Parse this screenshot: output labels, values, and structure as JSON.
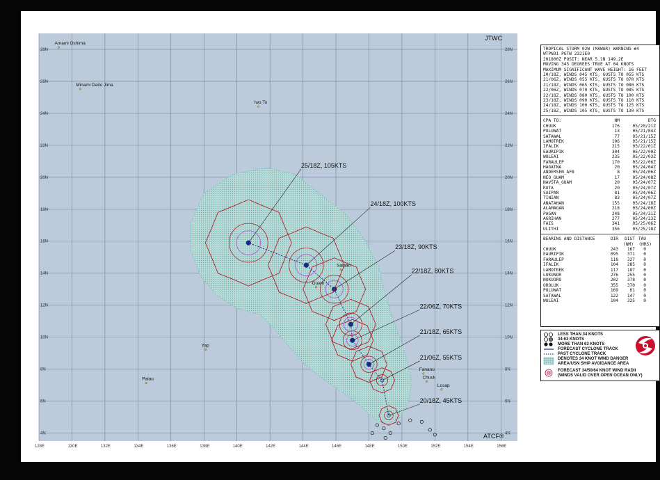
{
  "header": {
    "agency": "JTWC",
    "software": "ATCF®"
  },
  "warning_lines": [
    "TROPICAL STORM 02W (MAWAR) WARNING #4",
    "WTPN31 PGTW 2321E0",
    "201800Z POSIT: NEAR 5.1N 149.2E",
    "MOVING 345 DEGREES TRUE AT 04 KNOTS",
    "MAXIMUM SIGNIFICANT WAVE HEIGHT: 16 FEET",
    "20/18Z, WINDS 045 KTS, GUSTS TO 055 KTS",
    "21/06Z, WINDS 055 KTS, GUSTS TO 070 KTS",
    "21/18Z, WINDS 065 KTS, GUSTS TO 080 KTS",
    "22/06Z, WINDS 070 KTS, GUSTS TO 085 KTS",
    "22/18Z, WINDS 080 KTS, GUSTS TO 100 KTS",
    "23/18Z, WINDS 090 KTS, GUSTS TO 110 KTS",
    "24/18Z, WINDS 100 KTS, GUSTS TO 125 KTS",
    "25/18Z, WINDS 105 KTS, GUSTS TO 130 KTS"
  ],
  "cpa": {
    "headers": [
      "CPA TO:",
      "NM",
      "DTG"
    ],
    "rows": [
      [
        "CHUUK",
        "176",
        "05/20/21Z"
      ],
      [
        "PULUWAT",
        "13",
        "05/21/04Z"
      ],
      [
        "SATAWAL",
        "77",
        "05/21/15Z"
      ],
      [
        "LAMOTREK",
        "106",
        "05/21/15Z"
      ],
      [
        "IFALIK",
        "215",
        "05/22/01Z"
      ],
      [
        "EAURIPIK",
        "304",
        "05/22/00Z"
      ],
      [
        "WOLEAI",
        "235",
        "05/22/03Z"
      ],
      [
        "FARAULEP",
        "170",
        "05/22/06Z"
      ],
      [
        "HAGATNA",
        "20",
        "05/24/04Z"
      ],
      [
        "ANDERSEN_AFB",
        "8",
        "05/24/06Z"
      ],
      [
        "NEO_GUAM",
        "17",
        "05/24/08Z"
      ],
      [
        "NAVSTA_GUAM",
        "20",
        "05/24/07Z"
      ],
      [
        "ROTA",
        "20",
        "05/24/07Z"
      ],
      [
        "SAIPAN",
        "81",
        "05/24/06Z"
      ],
      [
        "TINIAN",
        "83",
        "05/24/07Z"
      ],
      [
        "ANATAHAN",
        "155",
        "05/24/18Z"
      ],
      [
        "ALAMAGAN",
        "218",
        "05/24/00Z"
      ],
      [
        "PAGAN",
        "248",
        "05/24/21Z"
      ],
      [
        "AGRIHAN",
        "277",
        "05/24/23Z"
      ],
      [
        "FAIS",
        "341",
        "05/25/06Z"
      ],
      [
        "ULITHI",
        "356",
        "05/25/18Z"
      ]
    ]
  },
  "bearing": {
    "title": "BEARING AND DISTANCE",
    "headers": [
      "DIR",
      "DIST",
      "TAU"
    ],
    "subheaders": [
      "(NM)",
      "(HRS)"
    ],
    "rows": [
      [
        "CHUUK",
        "243",
        "167",
        "0"
      ],
      [
        "EAURIPIK",
        "095",
        "371",
        "0"
      ],
      [
        "FARAULEP",
        "118",
        "327",
        "0"
      ],
      [
        "IFALIK",
        "104",
        "285",
        "0"
      ],
      [
        "LAMOTREK",
        "117",
        "187",
        "0"
      ],
      [
        "LUKUNOR",
        "276",
        "255",
        "0"
      ],
      [
        "NUKUORO",
        "202",
        "378",
        "0"
      ],
      [
        "OROLUK",
        "355",
        "370",
        "0"
      ],
      [
        "PULUWAT",
        "169",
        "61",
        "0"
      ],
      [
        "SATAWAL",
        "122",
        "147",
        "0"
      ],
      [
        "WOLEAI",
        "104",
        "325",
        "0"
      ]
    ]
  },
  "legend": [
    "LESS THAN 34 KNOTS",
    "34-63 KNOTS",
    "MORE THAN 63 KNOTS",
    "FORECAST CYCLONE TRACK",
    "PAST CYCLONE TRACK",
    "DENOTES 34 KNOT WIND DANGER",
    "AREA/USN SHIP AVOIDANCE AREA",
    "FORECAST 34/50/64 KNOT WIND RADII",
    "(WINDS VALID OVER OPEN OCEAN ONLY)"
  ],
  "map": {
    "lon_labels": [
      "128E",
      "130E",
      "132E",
      "134E",
      "136E",
      "138E",
      "140E",
      "142E",
      "144E",
      "146E",
      "148E",
      "150E",
      "152E",
      "154E",
      "156E"
    ],
    "lat_labels": [
      "28N",
      "26N",
      "24N",
      "22N",
      "20N",
      "18N",
      "16N",
      "14N",
      "12N",
      "10N",
      "8N",
      "6N",
      "4N"
    ],
    "lon_range": [
      128,
      157
    ],
    "lat_range": [
      3.5,
      29
    ],
    "place_names": [
      {
        "name": "Amami Oshima",
        "lon": 129.2,
        "lat": 28.3
      },
      {
        "name": "Minami Daito Jima",
        "lon": 130.5,
        "lat": 25.7
      },
      {
        "name": "Iwo To",
        "lon": 141.3,
        "lat": 24.6
      },
      {
        "name": "Yap",
        "lon": 138.1,
        "lat": 9.4
      },
      {
        "name": "Palau",
        "lon": 134.5,
        "lat": 7.3
      },
      {
        "name": "Fananu",
        "lon": 151.3,
        "lat": 7.9
      },
      {
        "name": "Chuuk",
        "lon": 151.5,
        "lat": 7.4
      },
      {
        "name": "Losap",
        "lon": 152.4,
        "lat": 6.9
      },
      {
        "name": "Saipan",
        "lon": 146.3,
        "lat": 14.4
      },
      {
        "name": "Guam",
        "lon": 144.8,
        "lat": 13.3
      }
    ],
    "forecast_points": [
      {
        "label": "20/18Z, 45KTS",
        "lon": 149.2,
        "lat": 5.1
      },
      {
        "label": "21/06Z, 55KTS",
        "lon": 148.8,
        "lat": 7.3
      },
      {
        "label": "21/18Z, 65KTS",
        "lon": 148.0,
        "lat": 8.3
      },
      {
        "label": "22/06Z, 70KTS",
        "lon": 147.0,
        "lat": 9.8
      },
      {
        "label": "22/18Z, 80KTS",
        "lon": 146.9,
        "lat": 10.8
      },
      {
        "label": "23/18Z, 90KTS",
        "lon": 145.9,
        "lat": 13.0
      },
      {
        "label": "24/18Z, 100KTS",
        "lon": 144.2,
        "lat": 14.5
      },
      {
        "label": "25/18Z, 105KTS",
        "lon": 140.7,
        "lat": 15.9
      }
    ],
    "past_points": [
      {
        "lon": 148.5,
        "lat": 4.5
      },
      {
        "lon": 148.9,
        "lat": 4.3
      },
      {
        "lon": 149.3,
        "lat": 4.0
      },
      {
        "lon": 149.8,
        "lat": 4.6
      },
      {
        "lon": 150.5,
        "lat": 4.8
      },
      {
        "lon": 151.2,
        "lat": 4.7
      },
      {
        "lon": 151.7,
        "lat": 4.2
      },
      {
        "lon": 152.0,
        "lat": 3.9
      },
      {
        "lon": 148.2,
        "lat": 4.0
      },
      {
        "lon": 149.0,
        "lat": 3.7
      }
    ]
  },
  "colors": {
    "ocean": "#b9c9d9",
    "danger_area": "#a7d6d4",
    "wind_radii": "#b0202a",
    "inner_radii": "#b05ad8",
    "cyclone_center": "#1a2a8a"
  }
}
